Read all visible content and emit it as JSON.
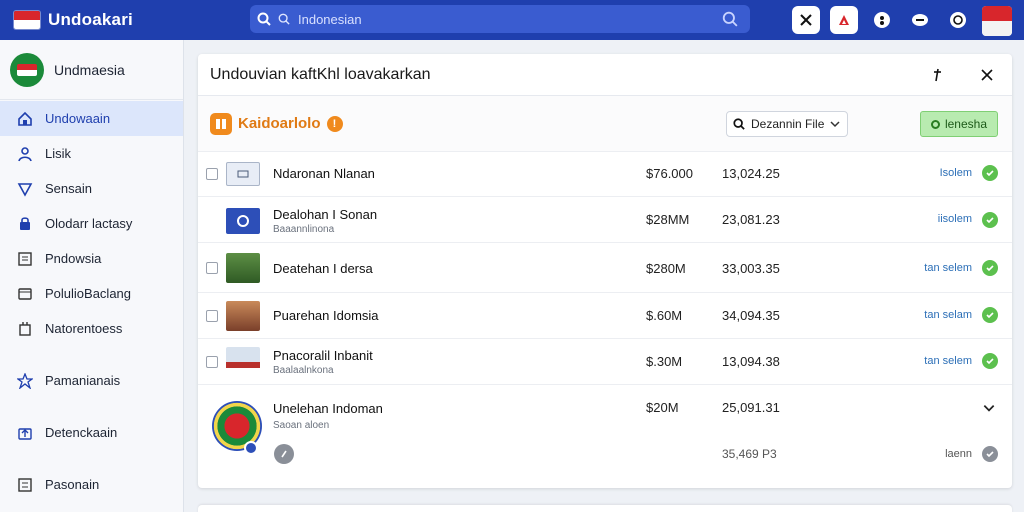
{
  "topbar": {
    "brand": "Undoakari",
    "search_placeholder": "Indonesian",
    "colors": {
      "bar": "#1f3fae",
      "accent_red": "#d8262c"
    }
  },
  "sidebar": {
    "title": "Undmaesia",
    "items": [
      {
        "label": "Undowaain",
        "icon": "home-icon",
        "active": true
      },
      {
        "label": "Lisik",
        "icon": "user-icon"
      },
      {
        "label": "Sensain",
        "icon": "shield-icon"
      },
      {
        "label": "Olodarr lactasy",
        "icon": "lock-icon"
      },
      {
        "label": "Pndowsia",
        "icon": "document-icon"
      },
      {
        "label": "PolulioBaclang",
        "icon": "card-icon"
      },
      {
        "label": "Natorentoess",
        "icon": "settings-icon"
      },
      {
        "label": "Pamanianais",
        "icon": "puzzle-icon"
      },
      {
        "label": "Detenckaain",
        "icon": "upload-icon"
      },
      {
        "label": "Pasonain",
        "icon": "list-icon"
      }
    ]
  },
  "panel": {
    "title": "Undouvian kaftKhl loavakarkan",
    "toolbar": {
      "label": "Kaidoarlolo",
      "dot": "!",
      "dropdown": "Dezannin File",
      "green_button": "lenesha"
    },
    "rows": [
      {
        "name": "Ndaronan Nlanan",
        "sub": "",
        "price": "$76.000",
        "num": "13,024.25",
        "status": "Isolem",
        "checkbox": true,
        "thumb": "icon-tile"
      },
      {
        "name": "Dealohan I Sonan",
        "sub": "Baaannlinona",
        "price": "$28MM",
        "num": "23,081.23",
        "status": "iisolem",
        "checkbox": false,
        "thumb": "blue-tile"
      },
      {
        "name": "Deatehan I dersa",
        "sub": "",
        "price": "$280M",
        "num": "33,003.35",
        "status": "tan selem",
        "checkbox": true,
        "thumb": "forest"
      },
      {
        "name": "Puarehan Idomsia",
        "sub": "",
        "price": "$.60M",
        "num": "34,094.35",
        "status": "tan selam",
        "checkbox": true,
        "thumb": "temple"
      },
      {
        "name": "Pnacoralil Inbanit",
        "sub": "Baalaalnkona",
        "price": "$.30M",
        "num": "13,094.38",
        "status": "tan selem",
        "checkbox": true,
        "thumb": "roof"
      },
      {
        "name": "Unelehan Indoman",
        "sub": "Saoan aloen",
        "price": "$20M",
        "num": "25,091.31",
        "status": "",
        "checkbox": false,
        "thumb": "emblem",
        "extra_num": "35,469 P3",
        "extra_status": "laenn"
      }
    ]
  }
}
